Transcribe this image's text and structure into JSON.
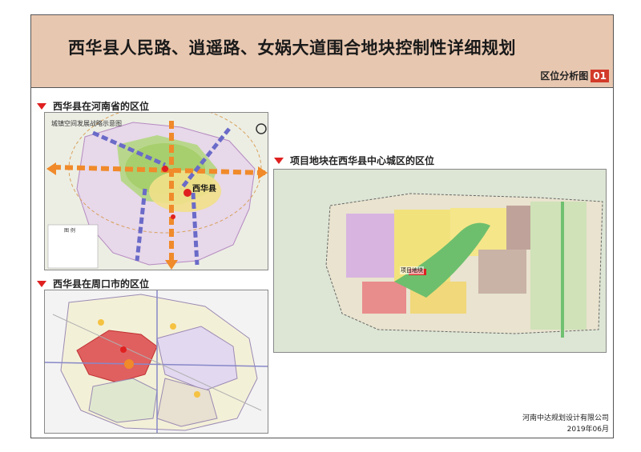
{
  "header": {
    "title": "西华县人民路、逍遥路、女娲大道围合地块控制性详细规划",
    "map_title": "区位分析图",
    "map_number": "01"
  },
  "sections": {
    "province": {
      "label": "西华县在河南省的区位",
      "map_caption": "城镇空间发展战略示意图",
      "county_label": "西华县",
      "legend_title": "图 例"
    },
    "city": {
      "label": "西华县在周口市的区位"
    },
    "center": {
      "label": "项目地块在西华县中心城区的区位",
      "site_label": "项目地块"
    }
  },
  "footer": {
    "company": "河南中达规划设计有限公司",
    "date": "2019年06月"
  },
  "colors": {
    "header_bg": "#e8c7b0",
    "accent_red": "#d23a2a",
    "marker": "#e02020"
  }
}
